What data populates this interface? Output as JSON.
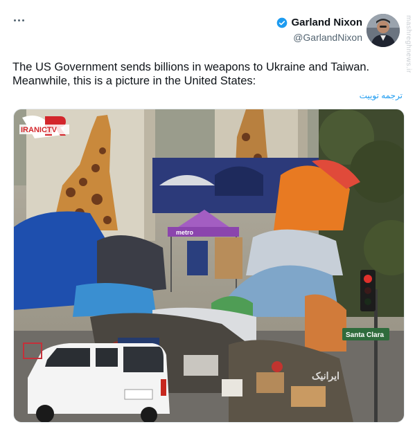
{
  "header": {
    "more_icon": "more-horizontal-icon",
    "author_name": "Garland Nixon",
    "author_handle": "@GarlandNixon",
    "verified_icon": "verified-badge-icon",
    "verified_color": "#1d9bf0"
  },
  "tweet": {
    "line1": "The US Government sends billions in weapons to Ukraine and Taiwan.",
    "line2": "Meanwhile, this is a picture in the United States:",
    "translate_label": "ترجمه توییت"
  },
  "photo": {
    "logo_text": "IRANICTV",
    "canopy_label": "metro",
    "street_sign": "Santa Clara",
    "bottom_watermark": "ایرانیک",
    "side_watermark": "mashreghnews.ir"
  }
}
